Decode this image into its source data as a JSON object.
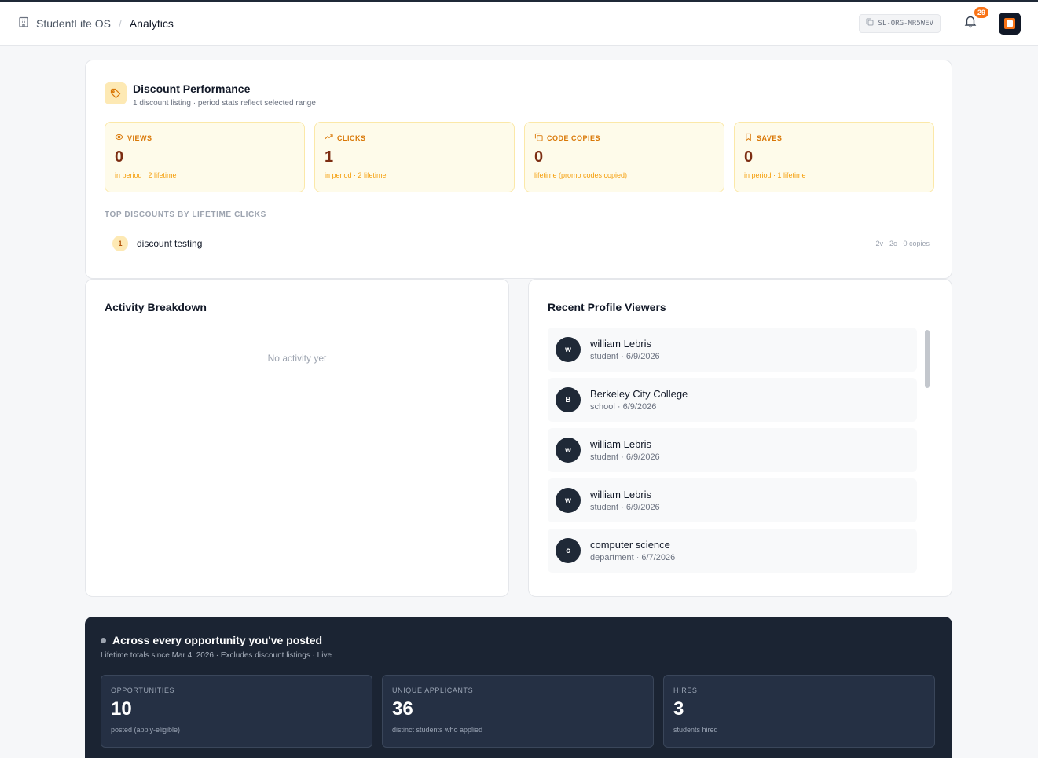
{
  "breadcrumb": {
    "app": "StudentLife OS",
    "separator": "/",
    "page": "Analytics"
  },
  "header": {
    "org_code": "SL-ORG-MR5WEV",
    "notification_count": "29"
  },
  "discount_performance": {
    "title": "Discount Performance",
    "subtitle": "1 discount listing · period stats reflect selected range",
    "stats": [
      {
        "icon": "eye-icon",
        "label": "VIEWS",
        "value": "0",
        "note": "in period · 2 lifetime"
      },
      {
        "icon": "trend-up-icon",
        "label": "CLICKS",
        "value": "1",
        "note": "in period · 2 lifetime"
      },
      {
        "icon": "copy-icon",
        "label": "CODE COPIES",
        "value": "0",
        "note": "lifetime (promo codes copied)"
      },
      {
        "icon": "bookmark-icon",
        "label": "SAVES",
        "value": "0",
        "note": "in period · 1 lifetime"
      }
    ],
    "top_heading": "TOP DISCOUNTS BY LIFETIME CLICKS",
    "top_list": [
      {
        "rank": "1",
        "name": "discount testing",
        "meta": "2v · 2c · 0 copies"
      }
    ]
  },
  "activity": {
    "title": "Activity Breakdown",
    "empty": "No activity yet"
  },
  "profile_viewers": {
    "title": "Recent Profile Viewers",
    "items": [
      {
        "initial": "w",
        "name": "william Lebris",
        "sub": "student · 6/9/2026"
      },
      {
        "initial": "B",
        "name": "Berkeley City College",
        "sub": "school · 6/9/2026"
      },
      {
        "initial": "w",
        "name": "william Lebris",
        "sub": "student · 6/9/2026"
      },
      {
        "initial": "w",
        "name": "william Lebris",
        "sub": "student · 6/9/2026"
      },
      {
        "initial": "c",
        "name": "computer science",
        "sub": "department · 6/7/2026"
      }
    ]
  },
  "opportunities": {
    "title": "Across every opportunity you've posted",
    "subtitle": "Lifetime totals since Mar 4, 2026 · Excludes discount listings · Live",
    "stats": [
      {
        "label": "OPPORTUNITIES",
        "value": "10",
        "note": "posted (apply-eligible)"
      },
      {
        "label": "UNIQUE APPLICANTS",
        "value": "36",
        "note": "distinct students who applied"
      },
      {
        "label": "HIRES",
        "value": "3",
        "note": "students hired"
      }
    ]
  },
  "colors": {
    "accent": "#f97316",
    "amber_text": "#d97706",
    "dark_panel": "#1b2433"
  }
}
